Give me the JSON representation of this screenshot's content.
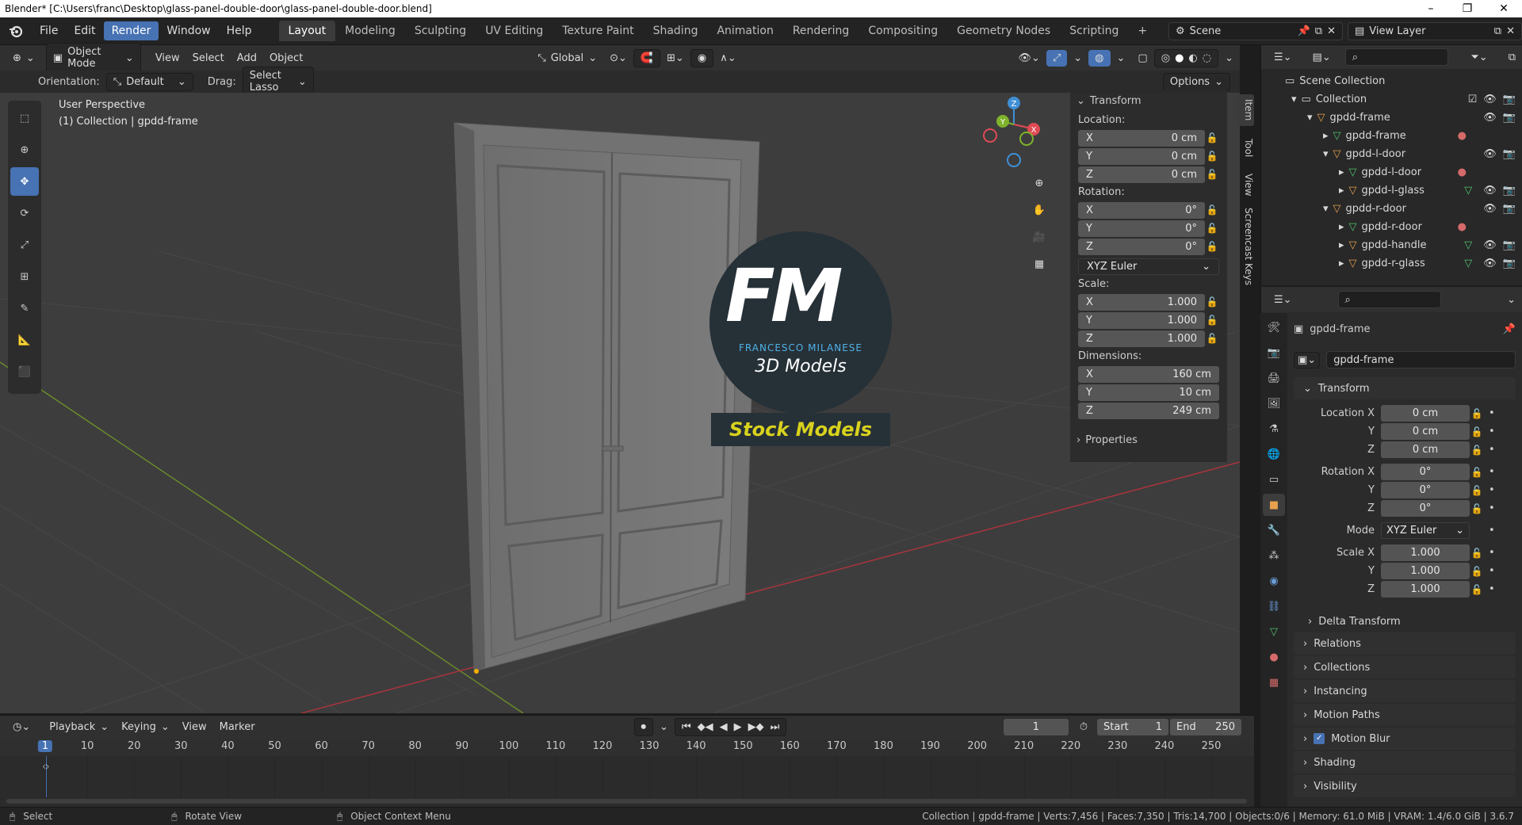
{
  "window": {
    "title": "Blender* [C:\\Users\\franc\\Desktop\\glass-panel-double-door\\glass-panel-double-door.blend]"
  },
  "menubar": {
    "items": [
      "File",
      "Edit",
      "Render",
      "Window",
      "Help"
    ],
    "active": "Render"
  },
  "workspaces": {
    "tabs": [
      "Layout",
      "Modeling",
      "Sculpting",
      "UV Editing",
      "Texture Paint",
      "Shading",
      "Animation",
      "Rendering",
      "Compositing",
      "Geometry Nodes",
      "Scripting"
    ],
    "active": "Layout",
    "add_label": "+"
  },
  "scene": {
    "name": "Scene"
  },
  "view_layer": {
    "name": "View Layer"
  },
  "viewport_header": {
    "mode": "Object Mode",
    "menus": [
      "View",
      "Select",
      "Add",
      "Object"
    ],
    "transform_orientation": "Global"
  },
  "tool_settings": {
    "orientation_label": "Orientation:",
    "orientation_value": "Default",
    "drag_label": "Drag:",
    "drag_value": "Select Lasso",
    "options_label": "Options"
  },
  "viewport": {
    "perspective": "User Perspective",
    "context": "(1) Collection | gpdd-frame",
    "watermark": {
      "letters": "FM",
      "name": "FRANCESCO MILANESE",
      "subtitle": "3D Models",
      "banner": "Stock Models"
    },
    "gizmo_axes": [
      "X",
      "Y",
      "Z"
    ]
  },
  "npanel": {
    "tabs": [
      "Item",
      "Tool",
      "View",
      "Screencast Keys"
    ],
    "title": "Transform",
    "location_label": "Location:",
    "rotation_label": "Rotation:",
    "scale_label": "Scale:",
    "dimensions_label": "Dimensions:",
    "location": [
      {
        "axis": "X",
        "value": "0 cm"
      },
      {
        "axis": "Y",
        "value": "0 cm"
      },
      {
        "axis": "Z",
        "value": "0 cm"
      }
    ],
    "rotation": [
      {
        "axis": "X",
        "value": "0°"
      },
      {
        "axis": "Y",
        "value": "0°"
      },
      {
        "axis": "Z",
        "value": "0°"
      }
    ],
    "rotation_mode": "XYZ Euler",
    "scale": [
      {
        "axis": "X",
        "value": "1.000"
      },
      {
        "axis": "Y",
        "value": "1.000"
      },
      {
        "axis": "Z",
        "value": "1.000"
      }
    ],
    "dimensions": [
      {
        "axis": "X",
        "value": "160 cm"
      },
      {
        "axis": "Y",
        "value": "10 cm"
      },
      {
        "axis": "Z",
        "value": "249 cm"
      }
    ],
    "properties_label": "Properties"
  },
  "outliner": {
    "root": "Scene Collection",
    "rows": [
      {
        "label": "Collection",
        "type": "collection"
      },
      {
        "label": "gpdd-frame",
        "type": "empty"
      },
      {
        "label": "gpdd-frame",
        "type": "mesh"
      },
      {
        "label": "gpdd-l-door",
        "type": "empty"
      },
      {
        "label": "gpdd-l-door",
        "type": "mesh"
      },
      {
        "label": "gpdd-l-glass",
        "type": "empty"
      },
      {
        "label": "gpdd-r-door",
        "type": "empty"
      },
      {
        "label": "gpdd-r-door",
        "type": "mesh"
      },
      {
        "label": "gpdd-handle",
        "type": "empty"
      },
      {
        "label": "gpdd-r-glass",
        "type": "empty"
      }
    ]
  },
  "properties": {
    "object_name": "gpdd-frame",
    "datablock_name": "gpdd-frame",
    "transform_title": "Transform",
    "location_x_label": "Location X",
    "rotation_x_label": "Rotation X",
    "scale_x_label": "Scale X",
    "y_label": "Y",
    "z_label": "Z",
    "mode_label": "Mode",
    "location": [
      "0 cm",
      "0 cm",
      "0 cm"
    ],
    "rotation": [
      "0°",
      "0°",
      "0°"
    ],
    "mode": "XYZ Euler",
    "scale": [
      "1.000",
      "1.000",
      "1.000"
    ],
    "delta_transform": "Delta Transform",
    "sections": [
      "Relations",
      "Collections",
      "Instancing",
      "Motion Paths",
      "Motion Blur",
      "Shading",
      "Visibility"
    ]
  },
  "timeline": {
    "menus": [
      "Playback",
      "Keying",
      "View",
      "Marker"
    ],
    "current_frame": "1",
    "start_label": "Start",
    "start_value": "1",
    "end_label": "End",
    "end_value": "250",
    "ruler": [
      "1",
      "10",
      "20",
      "30",
      "40",
      "50",
      "60",
      "70",
      "80",
      "90",
      "100",
      "110",
      "120",
      "130",
      "140",
      "150",
      "160",
      "170",
      "180",
      "190",
      "200",
      "210",
      "220",
      "230",
      "240",
      "250"
    ]
  },
  "statusbar": {
    "select": "Select",
    "rotate": "Rotate View",
    "context_menu": "Object Context Menu",
    "stats": "Collection | gpdd-frame | Verts:7,456 | Faces:7,350 | Tris:14,700 | Objects:0/6 | Memory: 61.0 MiB | VRAM: 1.4/6.0 GiB | 3.6.7"
  },
  "colors": {
    "accent": "#4772b3",
    "x_axis": "#e04a54",
    "y_axis": "#7fb32b",
    "z_axis": "#3f8fd6",
    "watermark_yellow": "#d8d21d"
  }
}
